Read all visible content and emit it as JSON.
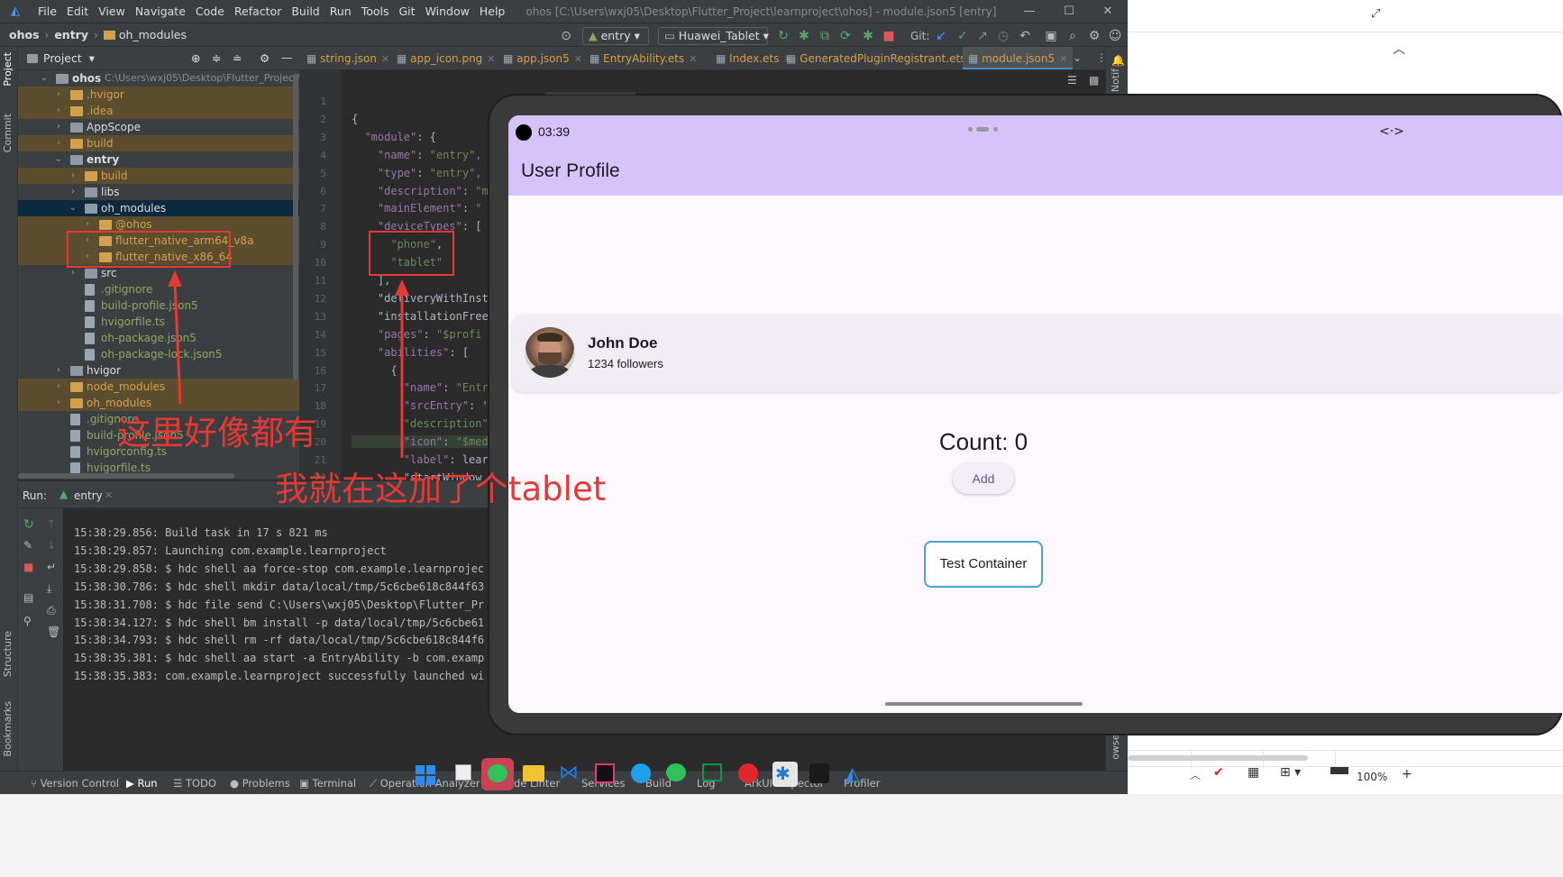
{
  "window": {
    "title": "ohos [C:\\Users\\wxj05\\Desktop\\Flutter_Project\\learnproject\\ohos] - module.json5 [entry]",
    "menu": [
      "File",
      "Edit",
      "View",
      "Navigate",
      "Code",
      "Refactor",
      "Build",
      "Run",
      "Tools",
      "Git",
      "Window",
      "Help"
    ],
    "controls": {
      "minimize": "—",
      "maximize": "☐",
      "close": "✕"
    }
  },
  "breadcrumb": [
    "ohos",
    "entry",
    "oh_modules"
  ],
  "toolbar": {
    "run_config": "entry",
    "device": "Huawei_Tablet",
    "git_label": "Git:"
  },
  "project_panel": {
    "header": "Project",
    "tree": [
      {
        "label": "ohos",
        "path": "C:\\Users\\wxj05\\Desktop\\Flutter_Project\\learnp",
        "type": "folder",
        "style": "root",
        "expanded": true
      },
      {
        "label": ".hvigor",
        "type": "folder",
        "style": "excluded"
      },
      {
        "label": ".idea",
        "type": "folder",
        "style": "excluded"
      },
      {
        "label": "AppScope",
        "type": "folder",
        "style": "normal"
      },
      {
        "label": "build",
        "type": "folder",
        "style": "excluded"
      },
      {
        "label": "entry",
        "type": "folder",
        "style": "bold",
        "expanded": true
      },
      {
        "label": "build",
        "type": "folder",
        "style": "excluded"
      },
      {
        "label": "libs",
        "type": "folder",
        "style": "normal"
      },
      {
        "label": "oh_modules",
        "type": "folder",
        "style": "selected",
        "expanded": true
      },
      {
        "label": "@ohos",
        "type": "folder",
        "style": "excluded"
      },
      {
        "label": "flutter_native_arm64_v8a",
        "type": "folder",
        "style": "excluded"
      },
      {
        "label": "flutter_native_x86_64",
        "type": "folder",
        "style": "excluded"
      },
      {
        "label": "src",
        "type": "folder",
        "style": "normal"
      },
      {
        "label": ".gitignore",
        "type": "file",
        "style": "green"
      },
      {
        "label": "build-profile.json5",
        "type": "file",
        "style": "green"
      },
      {
        "label": "hvigorfile.ts",
        "type": "file",
        "style": "green"
      },
      {
        "label": "oh-package.json5",
        "type": "file",
        "style": "green"
      },
      {
        "label": "oh-package-lock.json5",
        "type": "file",
        "style": "green"
      },
      {
        "label": "hvigor",
        "type": "folder",
        "style": "normal"
      },
      {
        "label": "node_modules",
        "type": "folder",
        "style": "excluded"
      },
      {
        "label": "oh_modules",
        "type": "folder",
        "style": "excluded"
      },
      {
        "label": ".gitignore",
        "type": "file",
        "style": "green"
      },
      {
        "label": "build-profile.json5",
        "type": "file",
        "style": "green"
      },
      {
        "label": "hvigorconfig.ts",
        "type": "file",
        "style": "green"
      },
      {
        "label": "hvigorfile.ts",
        "type": "file",
        "style": "green"
      }
    ]
  },
  "editor_tabs": [
    "string.json",
    "app_icon.png",
    "app.json5",
    "EntryAbility.ets",
    "Index.ets",
    "GeneratedPluginRegistrant.ets",
    "module.json5"
  ],
  "editor": {
    "lines": [
      {
        "n": "1",
        "text": ""
      },
      {
        "n": "2",
        "text": "{"
      },
      {
        "n": "3",
        "text": "  \"module\": {"
      },
      {
        "n": "4",
        "text": "    \"name\": \"entry\","
      },
      {
        "n": "5",
        "text": "    \"type\": \"entry\","
      },
      {
        "n": "6",
        "text": "    \"description\": \"m"
      },
      {
        "n": "7",
        "text": "    \"mainElement\": \""
      },
      {
        "n": "8",
        "text": "    \"deviceTypes\": ["
      },
      {
        "n": "9",
        "text": "      \"phone\","
      },
      {
        "n": "10",
        "text": "      \"tablet\""
      },
      {
        "n": "11",
        "text": "    ],"
      },
      {
        "n": "12",
        "text": "    \"deliveryWithInst"
      },
      {
        "n": "13",
        "text": "    \"installationFree"
      },
      {
        "n": "14",
        "text": "    \"pages\": \"$profi"
      },
      {
        "n": "15",
        "text": "    \"abilities\": ["
      },
      {
        "n": "16",
        "text": "      {"
      },
      {
        "n": "17",
        "text": "        \"name\": \"Entr"
      },
      {
        "n": "18",
        "text": "        \"srcEntry\": '"
      },
      {
        "n": "19",
        "text": "        \"description\""
      },
      {
        "n": "20",
        "text": "        \"icon\": \"$med"
      },
      {
        "n": "21",
        "text": "        \"label\": lear"
      },
      {
        "n": "22",
        "text": "        \"startWindow"
      }
    ]
  },
  "run_panel": {
    "label": "Run:",
    "tab": "entry",
    "log": [
      "15:38:29.856: Build task in 17 s 821 ms",
      "15:38:29.857: Launching com.example.learnproject",
      "15:38:29.858: $ hdc shell aa force-stop com.example.learnprojec",
      "15:38:30.786: $ hdc shell mkdir data/local/tmp/5c6cbe618c844f63",
      "15:38:31.708: $ hdc file send C:\\Users\\wxj05\\Desktop\\Flutter_Pr",
      "15:38:34.127: $ hdc shell bm install -p data/local/tmp/5c6cbe61",
      "15:38:34.793: $ hdc shell rm -rf data/local/tmp/5c6cbe618c844f6",
      "15:38:35.381: $ hdc shell aa start -a EntryAbility -b com.examp",
      "15:38:35.383: com.example.learnproject successfully launched wi"
    ]
  },
  "left_stripe": [
    "Project",
    "Commit",
    "Structure",
    "Bookmarks"
  ],
  "status_bar": [
    "Version Control",
    "Run",
    "TODO",
    "Problems",
    "Terminal",
    "Operation Analyzer",
    "de Linter",
    "Services",
    "Build",
    "Log",
    "ArkUI Inspector",
    "Profiler"
  ],
  "right_stripe": [
    "Notif",
    "owser"
  ],
  "taskbar": {
    "zoom": "100%"
  },
  "emulator": {
    "time": "03:39",
    "app_title": "User Profile",
    "profile": {
      "name": "John Doe",
      "followers": "1234 followers"
    },
    "count_label": "Count: 0",
    "add_button": "Add",
    "test_button": "Test Container"
  },
  "annotations": {
    "note_modules": "这里好像都有",
    "note_tablet": "我就在这加了个tablet"
  },
  "colors": {
    "accent_red": "#e53935",
    "appbar": "#d6c3fb",
    "ide_bg": "#2b2b2b"
  }
}
